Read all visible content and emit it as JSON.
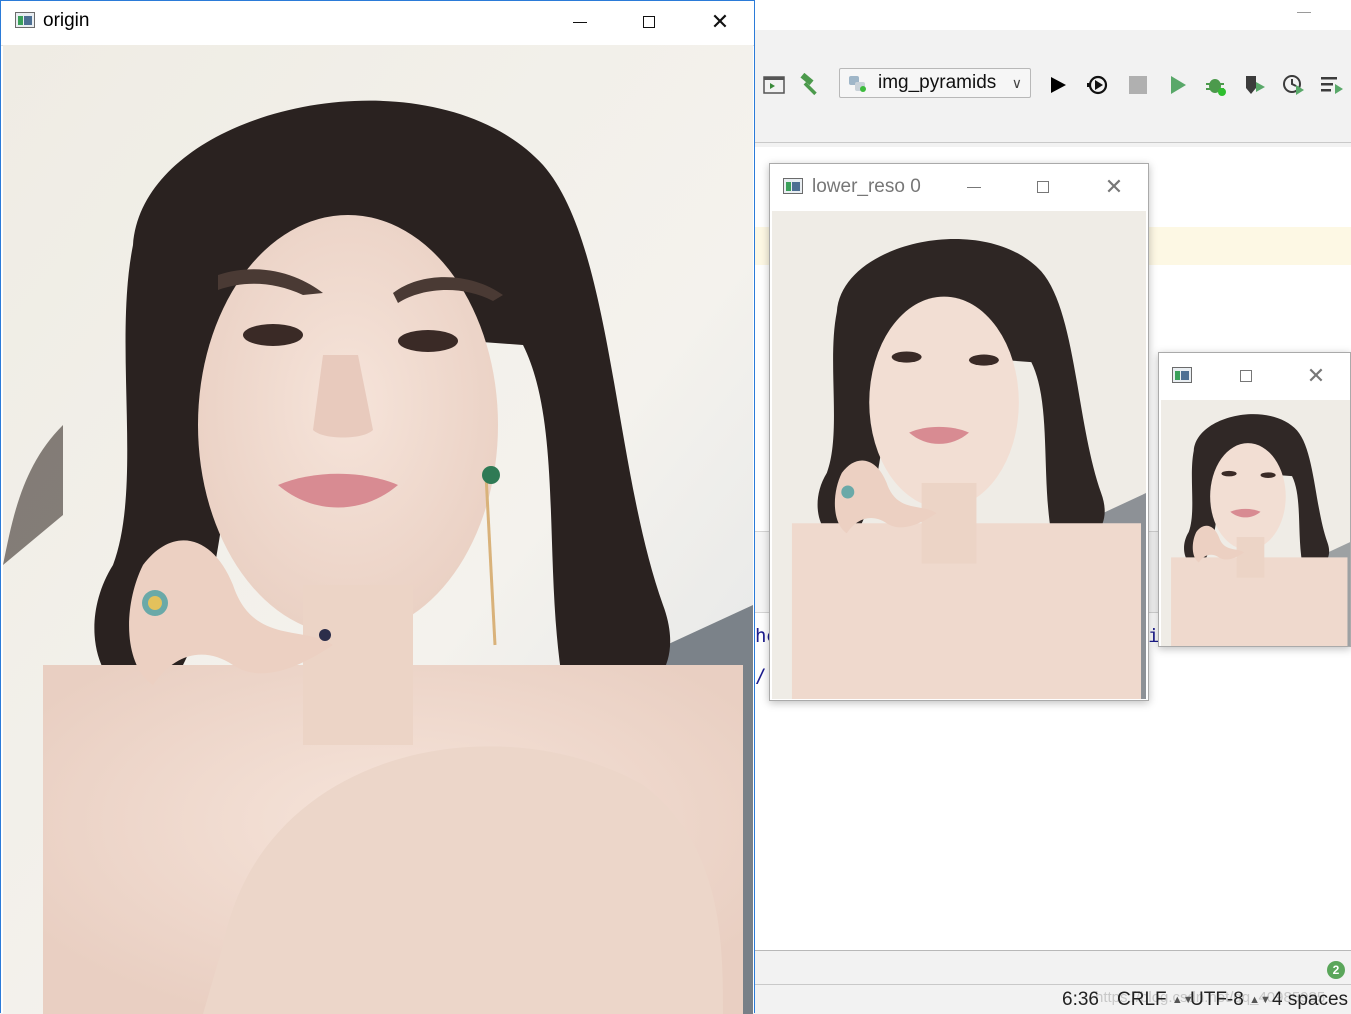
{
  "ide": {
    "run_configuration": "img_pyramids",
    "editor_fragment_1": "he",
    "editor_fragment_2": "/:",
    "editor_fragment_3": "ip",
    "notification_count": "2",
    "status": {
      "caret_position": "6:36",
      "line_separator": "CRLF",
      "encoding": "UTF-8",
      "indent": "4 spaces"
    },
    "watermark": "https://blog.csdn.net/qq_40985985"
  },
  "windows": {
    "origin": {
      "title": "origin"
    },
    "lower_reso_0": {
      "title": "lower_reso 0"
    },
    "lower_reso_1": {
      "title": ""
    }
  },
  "icons": {
    "window": "opencv-window-icon",
    "minimize": "minimize-icon",
    "maximize": "maximize-icon",
    "close": "close-icon",
    "toolbar": [
      "layout-icon",
      "build-hammer-icon",
      "python-icon",
      "run-icon",
      "debug-icon",
      "stop-icon",
      "run-green-icon",
      "bug-icon",
      "coverage-icon",
      "profile-icon",
      "run-list-icon"
    ]
  },
  "colors": {
    "focus_border": "#2b7bd8",
    "run_green": "#59a869",
    "badge_green": "#5aa65a"
  }
}
